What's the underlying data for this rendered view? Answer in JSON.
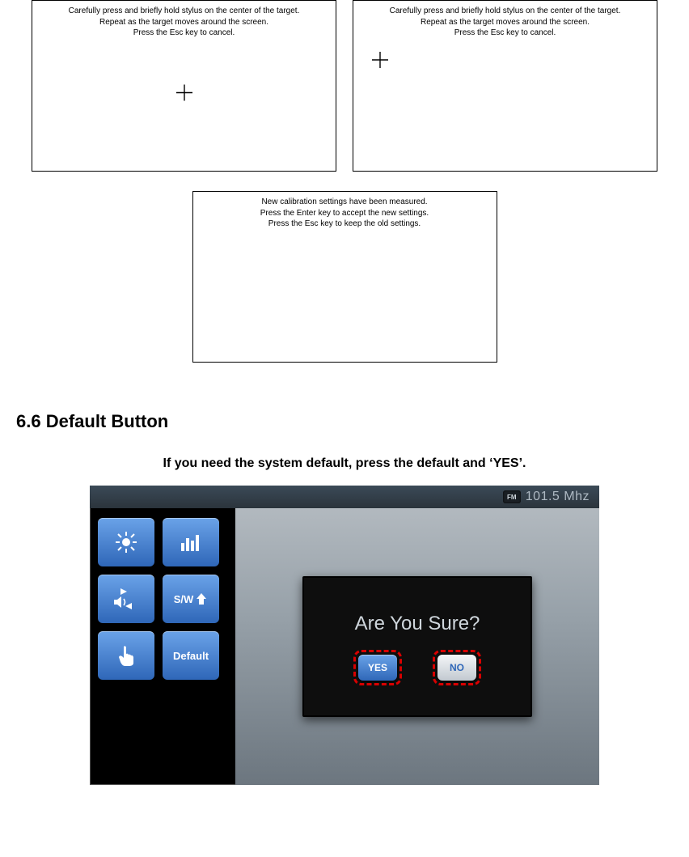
{
  "calibration": {
    "line1": "Carefully press and briefly hold stylus on the center of the target.",
    "line2": "Repeat as the target moves around the screen.",
    "line3": "Press the Esc key to cancel.",
    "finish_line1": "New calibration settings have been measured.",
    "finish_line2": "Press the Enter key to accept the new settings.",
    "finish_line3": "Press the Esc key to keep the old settings."
  },
  "section": {
    "heading": "6.6 Default Button",
    "subtitle": "If you need the system default, press the default and ‘YES’."
  },
  "device": {
    "fm_label": "FM",
    "fm_freq": "101.5 Mhz",
    "sidebar": {
      "brightness": "brightness",
      "equalizer": "equalizer",
      "volume": "volume",
      "sw_up": "S/W",
      "touch": "touch",
      "default": "Default"
    },
    "dialog": {
      "title": "Are You Sure?",
      "yes": "YES",
      "no": "NO"
    }
  }
}
